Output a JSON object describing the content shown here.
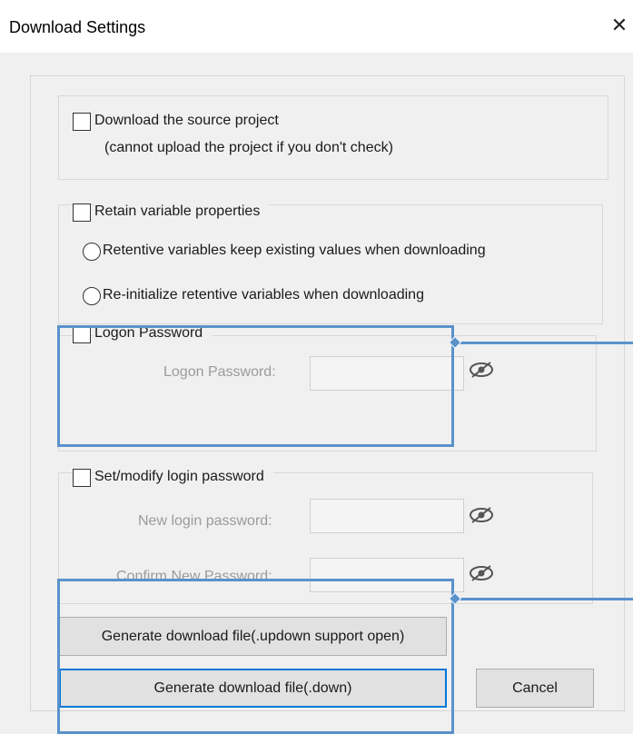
{
  "dialog": {
    "title": "Download Settings",
    "close_glyph": "✕"
  },
  "source_project": {
    "checkbox_label": "Download the source project",
    "note": "(cannot upload the project if you don't check)",
    "checked": false
  },
  "retain_variables": {
    "checkbox_label": "Retain variable properties",
    "checked": false,
    "options": [
      {
        "label": "Retentive variables keep existing values when downloading",
        "selected": false
      },
      {
        "label": "Re-initialize retentive variables when downloading",
        "selected": false
      }
    ]
  },
  "logon_password": {
    "checkbox_label": "Logon Password",
    "checked": false,
    "field_label": "Logon Password:",
    "value": ""
  },
  "login_password": {
    "checkbox_label": "Set/modify login password",
    "checked": false,
    "new_label": "New login password:",
    "confirm_label": "Confirm New Password:",
    "new_value": "",
    "confirm_value": ""
  },
  "buttons": {
    "generate_updown": "Generate download file(.updown support open)",
    "generate_down": "Generate download file(.down)",
    "cancel": "Cancel"
  },
  "icons": {
    "eye": "eye-slash-icon"
  },
  "colors": {
    "highlight": "#5a92cc",
    "focus": "#0078d7",
    "dialog_bg": "#f0f0f0"
  }
}
